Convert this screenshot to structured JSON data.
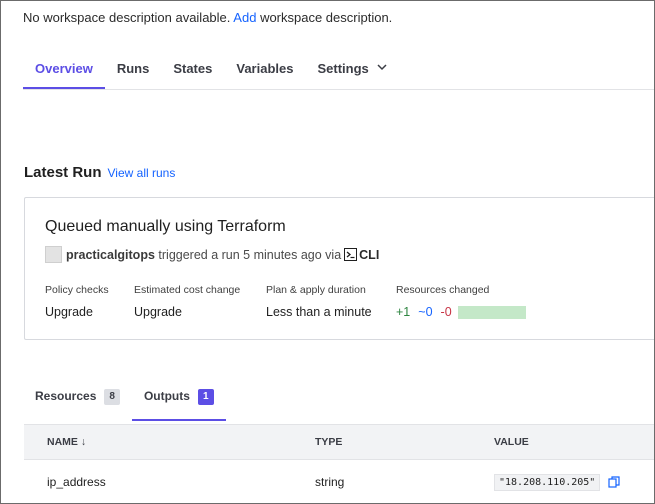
{
  "workspace": {
    "description_text": "No workspace description available.",
    "add_link": "Add",
    "description_suffix": "workspace description."
  },
  "tabs": [
    {
      "label": "Overview",
      "active": true
    },
    {
      "label": "Runs"
    },
    {
      "label": "States"
    },
    {
      "label": "Variables"
    },
    {
      "label": "Settings",
      "icon": "chevron-down-icon"
    }
  ],
  "latest_run": {
    "heading": "Latest Run",
    "view_all": "View all runs",
    "title": "Queued manually using Terraform",
    "user": "practicalgitops",
    "triggered_text": "triggered a run 5 minutes ago via",
    "via": "CLI",
    "stats": {
      "policy_checks": {
        "label": "Policy checks",
        "value": "Upgrade"
      },
      "cost_change": {
        "label": "Estimated cost change",
        "value": "Upgrade"
      },
      "duration": {
        "label": "Plan & apply duration",
        "value": "Less than a minute"
      },
      "resources_changed": {
        "label": "Resources changed",
        "add": "+1",
        "change": "~0",
        "destroy": "-0"
      }
    }
  },
  "bottom_tabs": [
    {
      "label": "Resources",
      "count": "8"
    },
    {
      "label": "Outputs",
      "count": "1",
      "active": true
    }
  ],
  "outputs_table": {
    "headers": {
      "name": "NAME ↓",
      "type": "TYPE",
      "value": "VALUE"
    },
    "rows": [
      {
        "name": "ip_address",
        "type": "string",
        "value": "\"18.208.110.205\""
      }
    ]
  },
  "colors": {
    "accent": "#5c4ee5",
    "link": "#1563ff",
    "add": "#2e8540",
    "destroy": "#c73445"
  }
}
